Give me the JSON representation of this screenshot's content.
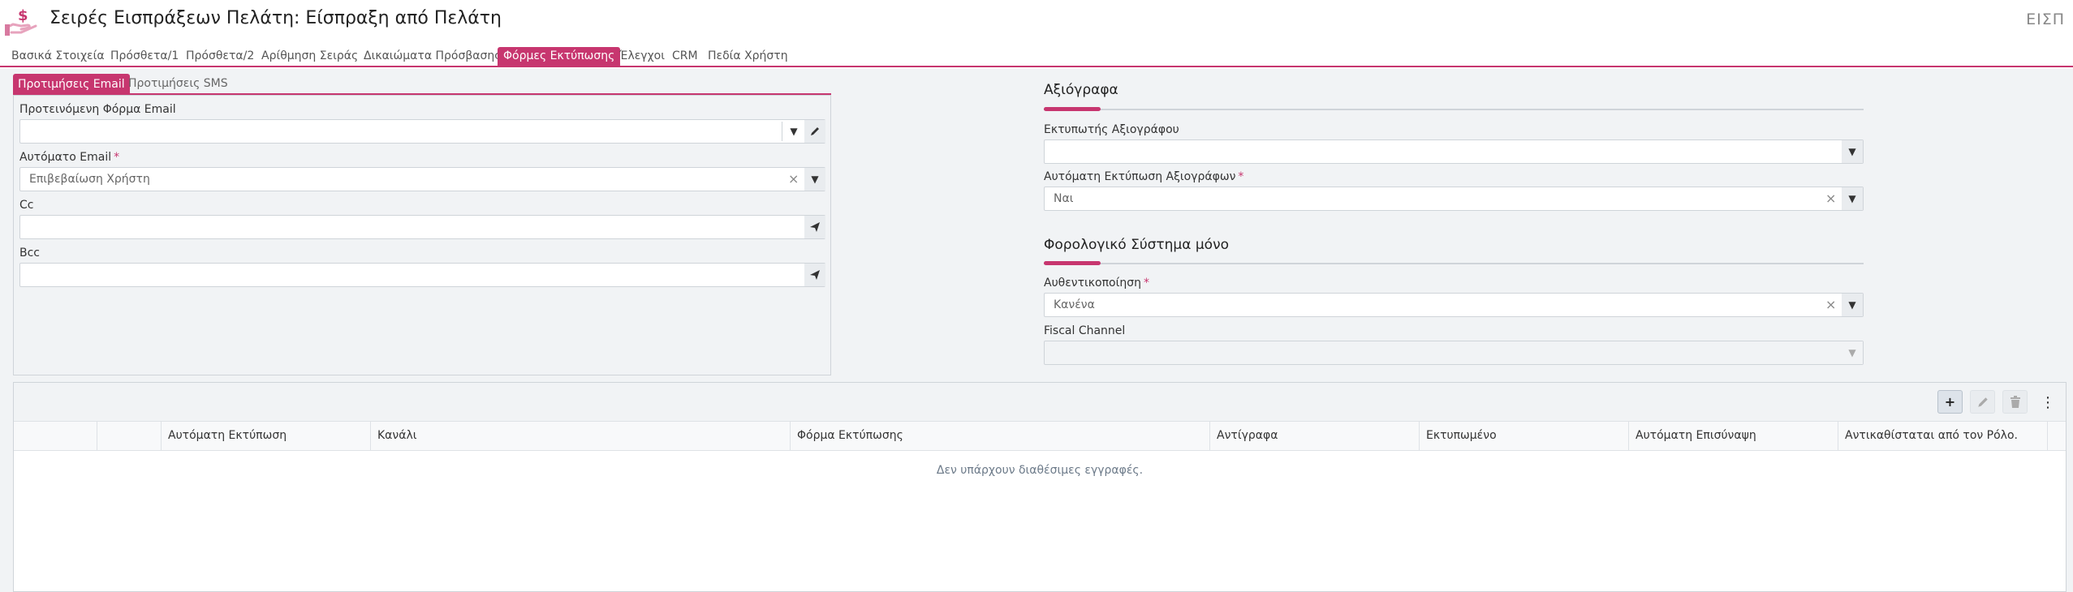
{
  "header": {
    "title": "Σειρές Εισπράξεων Πελάτη: Είσπραξη από Πελάτη",
    "code": "ΕΙΣΠ",
    "icon": "hand-money-icon"
  },
  "tabs": [
    {
      "label": "Βασικά Στοιχεία"
    },
    {
      "label": "Πρόσθετα/1"
    },
    {
      "label": "Πρόσθετα/2"
    },
    {
      "label": "Αρίθμηση Σειράς"
    },
    {
      "label": "Δικαιώματα Πρόσβασης"
    },
    {
      "label": "Φόρμες Εκτύπωσης",
      "active": true
    },
    {
      "label": "Έλεγχοι"
    },
    {
      "label": "CRM"
    },
    {
      "label": "Πεδία Χρήστη"
    }
  ],
  "subtabs": [
    {
      "label": "Προτιμήσεις Email",
      "active": true
    },
    {
      "label": "Προτιμήσεις SMS"
    }
  ],
  "email": {
    "preferred_form_label": "Προτεινόμενη Φόρμα Email",
    "preferred_form_value": "",
    "auto_email_label": "Αυτόματο Email",
    "auto_email_value": "Επιβεβαίωση Χρήστη",
    "cc_label": "Cc",
    "cc_value": "",
    "bcc_label": "Bcc",
    "bcc_value": ""
  },
  "valuables": {
    "title": "Αξιόγραφα",
    "printer_label": "Εκτυπωτής Αξιογράφου",
    "printer_value": "",
    "auto_print_label": "Αυτόματη Εκτύπωση Αξιογράφων",
    "auto_print_value": "Ναι"
  },
  "fiscal": {
    "title": "Φορολογικό Σύστημα μόνο",
    "auth_label": "Αυθεντικοποίηση",
    "auth_value": "Κανένα",
    "channel_label": "Fiscal Channel",
    "channel_value": ""
  },
  "grid": {
    "columns": [
      "",
      "",
      "Αυτόματη Εκτύπωση",
      "Κανάλι",
      "Φόρμα Εκτύπωσης",
      "Αντίγραφα",
      "Εκτυπωμένο",
      "Αυτόματη Επισύναψη",
      "Αντικαθίσταται από τον Ρόλο."
    ],
    "empty_text": "Δεν υπάρχουν διαθέσιμες εγγραφές.",
    "toolbar": {
      "add": "+",
      "edit_icon": "pencil-icon",
      "delete_icon": "trash-icon",
      "more": "⋮"
    }
  },
  "colors": {
    "accent": "#c7366f",
    "background": "#f1f3f5"
  }
}
